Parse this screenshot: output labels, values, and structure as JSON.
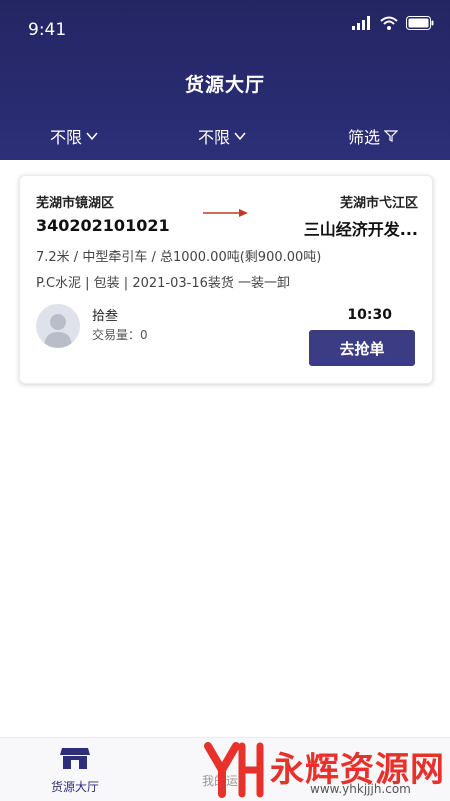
{
  "status_bar": {
    "time": "9:41"
  },
  "header": {
    "title": "货源大厅"
  },
  "filters": [
    {
      "label": "不限",
      "icon": "chevron-down-icon"
    },
    {
      "label": "不限",
      "icon": "chevron-down-icon"
    },
    {
      "label": "筛选",
      "icon": "filter-icon"
    }
  ],
  "card": {
    "from_city": "芜湖市镜湖区",
    "from_place": "340202101021",
    "to_city": "芜湖市弋江区",
    "to_place": "三山经济开发...",
    "spec": "7.2米 / 中型牵引车 / 总1000.00吨(剩900.00吨)",
    "cargo": "P.C水泥 | 包装 | 2021-03-16装货  一装一卸",
    "shipper_name": "拾叁",
    "deal_count": "交易量：0",
    "time": "10:30",
    "action_label": "去抢单"
  },
  "tabbar": [
    {
      "label": "货源大厅",
      "icon": "store-icon",
      "active": true
    },
    {
      "label": "我的运",
      "icon": "truck-icon",
      "active": false
    }
  ],
  "watermark": {
    "text": "永辉资源网",
    "url": "www.yhkjjjh.com"
  },
  "colors": {
    "header": "#2d2f78",
    "button": "#3c3c85",
    "arrow": "#c0392b",
    "watermark": "#e8312b"
  }
}
